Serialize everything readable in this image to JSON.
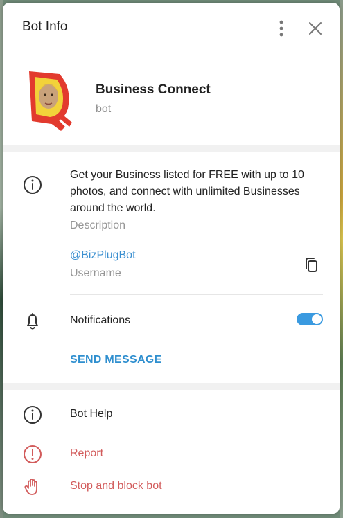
{
  "header": {
    "title": "Bot Info",
    "menu_icon": "more-vertical-icon",
    "close_icon": "close-icon"
  },
  "profile": {
    "name": "Business Connect",
    "subtitle": "bot",
    "avatar_icon": "bot-avatar-logo"
  },
  "info": {
    "description": "Get your Business listed for FREE with up to 10 photos, and connect with unlimited Businesses around the world.",
    "description_label": "Description",
    "username": "@BizPlugBot",
    "username_label": "Username",
    "copy_icon": "copy-icon"
  },
  "notifications": {
    "label": "Notifications",
    "enabled": true
  },
  "actions": {
    "send_message": "SEND MESSAGE",
    "bot_help": "Bot Help",
    "report": "Report",
    "stop_block": "Stop and block bot"
  },
  "colors": {
    "accent": "#3a8fd0",
    "danger": "#d25b5b",
    "toggle_on": "#3a9ae0"
  }
}
